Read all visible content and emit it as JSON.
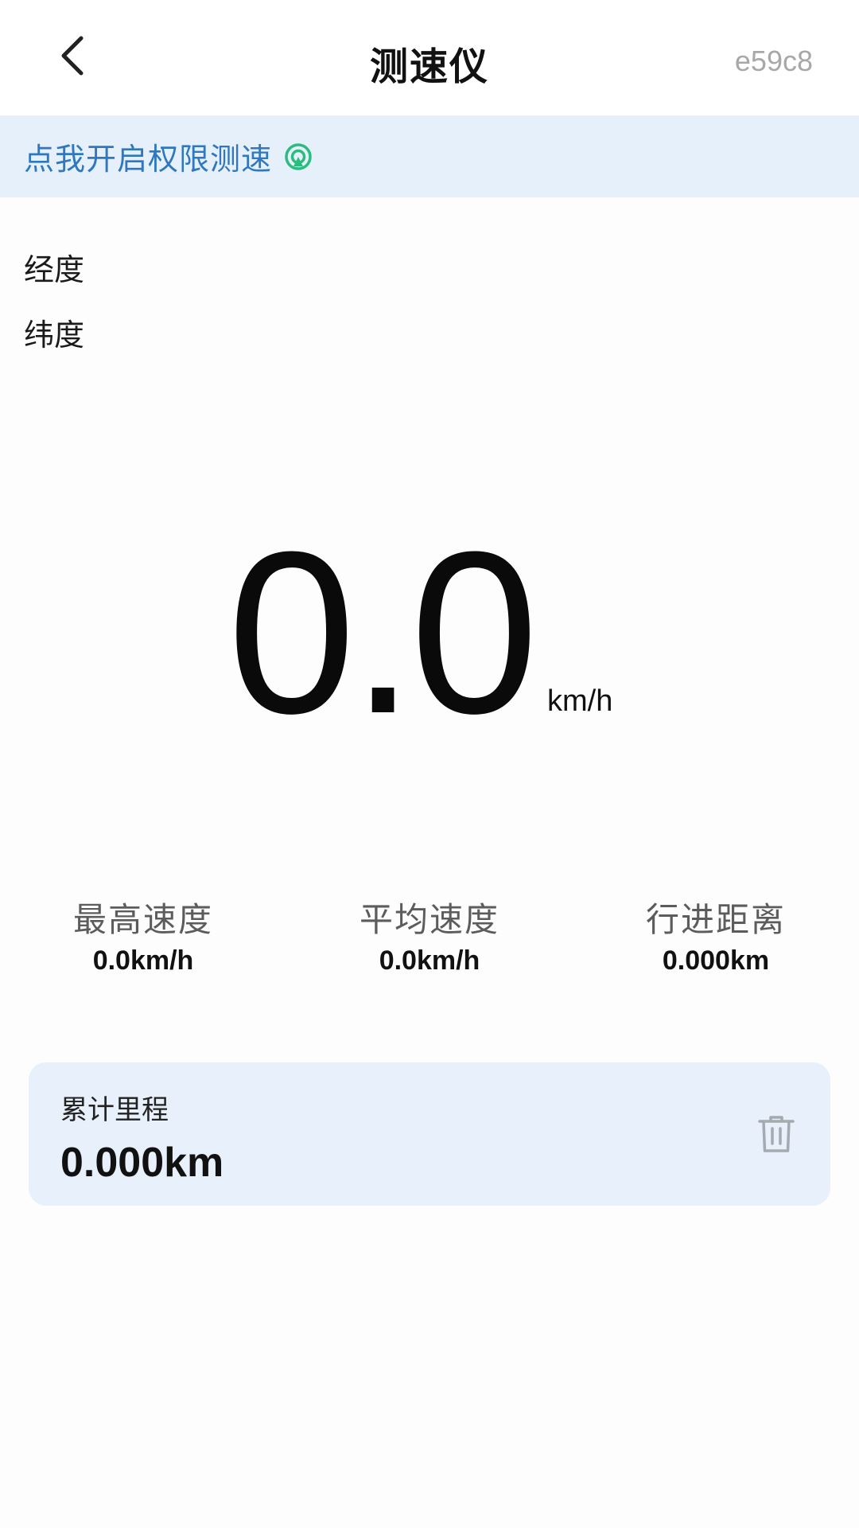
{
  "header": {
    "title": "测速仪",
    "device_code": "e59c8",
    "back_icon": "chevron-left-icon"
  },
  "permission_banner": {
    "text": "点我开启权限测速",
    "icon": "gps-signal-icon",
    "text_color": "#2f78bf",
    "icon_color": "#2bbd7e",
    "background": "#e6f0fb"
  },
  "coordinates": {
    "longitude_label": "经度",
    "latitude_label": "纬度"
  },
  "speedometer": {
    "value": "0.0",
    "unit": "km/h"
  },
  "stats": {
    "max_speed": {
      "label": "最高速度",
      "value": "0.0km/h"
    },
    "avg_speed": {
      "label": "平均速度",
      "value": "0.0km/h"
    },
    "distance": {
      "label": "行进距离",
      "value": "0.000km"
    }
  },
  "mileage_card": {
    "label": "累计里程",
    "value": "0.000km",
    "clear_icon": "trash-icon",
    "background": "#e8f0fb"
  }
}
